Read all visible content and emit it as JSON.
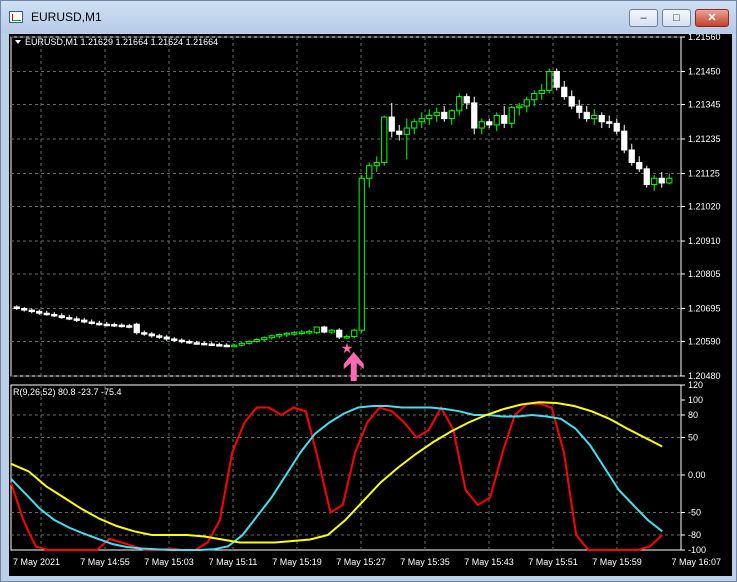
{
  "window": {
    "title": "EURUSD,M1",
    "controls": {
      "minimize": "–",
      "maximize": "□",
      "close": "✕"
    }
  },
  "chart_data": [
    {
      "type": "candlestick",
      "header": "EURUSD,M1  1.21629 1.21664 1.21624 1.21664",
      "price_labels": [
        "1.21560",
        "1.21450",
        "1.21345",
        "1.21235",
        "1.21125",
        "1.21020",
        "1.20910",
        "1.20805",
        "1.20695",
        "1.20590",
        "1.20480"
      ],
      "ylim": [
        1.2048,
        1.2156
      ],
      "colors": {
        "bull": "#00ff00",
        "bear": "#ffffff",
        "grid": "#5f6f5f",
        "signal_star": "#ff69b4",
        "signal_arrow": "#ff69b4"
      },
      "candles": [
        [
          1.207,
          1.20705,
          1.2069,
          1.20695
        ],
        [
          1.20695,
          1.207,
          1.20685,
          1.2069
        ],
        [
          1.2069,
          1.20695,
          1.2068,
          1.20686
        ],
        [
          1.20686,
          1.20692,
          1.20675,
          1.2068
        ],
        [
          1.2068,
          1.20688,
          1.20672,
          1.20676
        ],
        [
          1.20676,
          1.20684,
          1.20668,
          1.20672
        ],
        [
          1.20672,
          1.2068,
          1.20662,
          1.20666
        ],
        [
          1.20666,
          1.20674,
          1.20658,
          1.20662
        ],
        [
          1.20662,
          1.2067,
          1.20652,
          1.20658
        ],
        [
          1.20658,
          1.20665,
          1.20648,
          1.20652
        ],
        [
          1.20652,
          1.2066,
          1.20644,
          1.20648
        ],
        [
          1.20648,
          1.20656,
          1.2064,
          1.20645
        ],
        [
          1.20645,
          1.20652,
          1.20638,
          1.20644
        ],
        [
          1.20644,
          1.2065,
          1.20636,
          1.20642
        ],
        [
          1.20642,
          1.20648,
          1.20634,
          1.2064
        ],
        [
          1.2064,
          1.20646,
          1.20632,
          1.20638
        ],
        [
          1.20645,
          1.2065,
          1.20612,
          1.20618
        ],
        [
          1.20618,
          1.20625,
          1.20608,
          1.20614
        ],
        [
          1.20614,
          1.2062,
          1.20602,
          1.20608
        ],
        [
          1.20608,
          1.20614,
          1.20598,
          1.20604
        ],
        [
          1.20604,
          1.2061,
          1.20592,
          1.20598
        ],
        [
          1.20598,
          1.20604,
          1.20588,
          1.20594
        ],
        [
          1.20594,
          1.206,
          1.20584,
          1.2059
        ],
        [
          1.2059,
          1.20596,
          1.20582,
          1.20586
        ],
        [
          1.20586,
          1.20592,
          1.2058,
          1.20584
        ],
        [
          1.20584,
          1.2059,
          1.20578,
          1.20582
        ],
        [
          1.20582,
          1.20588,
          1.20576,
          1.2058
        ],
        [
          1.2058,
          1.20586,
          1.20574,
          1.20578
        ],
        [
          1.20578,
          1.20584,
          1.20573,
          1.20576
        ],
        [
          1.20576,
          1.20582,
          1.20572,
          1.20578
        ],
        [
          1.20578,
          1.20588,
          1.20574,
          1.20584
        ],
        [
          1.20584,
          1.20594,
          1.2058,
          1.2059
        ],
        [
          1.2059,
          1.206,
          1.20586,
          1.20596
        ],
        [
          1.20596,
          1.20606,
          1.2059,
          1.20602
        ],
        [
          1.20602,
          1.20612,
          1.20596,
          1.20608
        ],
        [
          1.20608,
          1.20616,
          1.206,
          1.20612
        ],
        [
          1.20612,
          1.2062,
          1.20604,
          1.20616
        ],
        [
          1.20616,
          1.20624,
          1.20608,
          1.20618
        ],
        [
          1.20618,
          1.20626,
          1.2061,
          1.2062
        ],
        [
          1.2062,
          1.20628,
          1.20612,
          1.20622
        ],
        [
          1.20618,
          1.2063,
          1.20614,
          1.20636
        ],
        [
          1.20636,
          1.2064,
          1.20616,
          1.2062
        ],
        [
          1.2062,
          1.2063,
          1.20614,
          1.20626
        ],
        [
          1.20626,
          1.20632,
          1.20598,
          1.20604
        ],
        [
          1.20604,
          1.20612,
          1.20598,
          1.20606
        ],
        [
          1.20606,
          1.2063,
          1.206,
          1.20626
        ],
        [
          1.20626,
          1.2112,
          1.20618,
          1.2111
        ],
        [
          1.2111,
          1.2116,
          1.2108,
          1.2115
        ],
        [
          1.2115,
          1.2118,
          1.2113,
          1.2116
        ],
        [
          1.2116,
          1.2131,
          1.2115,
          1.21305
        ],
        [
          1.21305,
          1.2135,
          1.2124,
          1.2126
        ],
        [
          1.2126,
          1.2128,
          1.2123,
          1.2125
        ],
        [
          1.2125,
          1.213,
          1.2117,
          1.2127
        ],
        [
          1.2127,
          1.213,
          1.2125,
          1.2129
        ],
        [
          1.2129,
          1.2132,
          1.2127,
          1.213
        ],
        [
          1.213,
          1.2133,
          1.2128,
          1.2131
        ],
        [
          1.2131,
          1.21335,
          1.2129,
          1.2132
        ],
        [
          1.2132,
          1.2134,
          1.2129,
          1.213
        ],
        [
          1.213,
          1.2133,
          1.2128,
          1.21325
        ],
        [
          1.21325,
          1.2138,
          1.2131,
          1.2137
        ],
        [
          1.2137,
          1.2138,
          1.2133,
          1.2135
        ],
        [
          1.2135,
          1.2137,
          1.2125,
          1.2127
        ],
        [
          1.2127,
          1.213,
          1.2125,
          1.2129
        ],
        [
          1.2129,
          1.213,
          1.2127,
          1.2128
        ],
        [
          1.2128,
          1.2132,
          1.2126,
          1.2131
        ],
        [
          1.2131,
          1.2134,
          1.2127,
          1.21285
        ],
        [
          1.21285,
          1.2134,
          1.2127,
          1.21335
        ],
        [
          1.21335,
          1.2135,
          1.2131,
          1.2134
        ],
        [
          1.2134,
          1.2137,
          1.2132,
          1.2136
        ],
        [
          1.2136,
          1.2139,
          1.2134,
          1.2138
        ],
        [
          1.2138,
          1.2141,
          1.2136,
          1.2139
        ],
        [
          1.2139,
          1.2146,
          1.2138,
          1.2145
        ],
        [
          1.2145,
          1.2146,
          1.2139,
          1.214
        ],
        [
          1.214,
          1.2142,
          1.2136,
          1.2137
        ],
        [
          1.2137,
          1.2139,
          1.2133,
          1.2134
        ],
        [
          1.2134,
          1.2136,
          1.213,
          1.2132
        ],
        [
          1.2132,
          1.2134,
          1.2129,
          1.213
        ],
        [
          1.213,
          1.2133,
          1.2128,
          1.2131
        ],
        [
          1.2131,
          1.2132,
          1.2127,
          1.2129
        ],
        [
          1.2129,
          1.2131,
          1.2127,
          1.21285
        ],
        [
          1.21285,
          1.213,
          1.2125,
          1.2126
        ],
        [
          1.2126,
          1.2128,
          1.2119,
          1.212
        ],
        [
          1.212,
          1.2122,
          1.2115,
          1.2116
        ],
        [
          1.2116,
          1.2118,
          1.2113,
          1.2114
        ],
        [
          1.2114,
          1.2115,
          1.2108,
          1.2109
        ],
        [
          1.2109,
          1.2112,
          1.2107,
          1.2111
        ],
        [
          1.2111,
          1.2113,
          1.2108,
          1.21095
        ],
        [
          1.21095,
          1.21125,
          1.2109,
          1.2111
        ]
      ],
      "signal_candle_index": 44
    },
    {
      "type": "line",
      "header": "R(9,26,52) 80.8 -23.7 -75.4",
      "ylim": [
        -100,
        120
      ],
      "scale_labels": [
        "120",
        "100",
        "80",
        "50",
        "0.00",
        "-50",
        "-80",
        "-100"
      ],
      "scale_values": [
        120,
        100,
        80,
        50,
        0,
        -50,
        -80,
        -100
      ],
      "x_tick_labels": [
        "7 May 2021",
        "7 May 14:55",
        "7 May 15:03",
        "7 May 15:11",
        "7 May 15:19",
        "7 May 15:27",
        "7 May 15:35",
        "7 May 15:43",
        "7 May 15:51",
        "7 May 15:59",
        "7 May 16:07"
      ],
      "series": [
        {
          "color": "#ff0000",
          "values": [
            -10,
            -60,
            -95,
            -100,
            -100,
            -100,
            -100,
            -100,
            -85,
            -90,
            -95,
            -100,
            -100,
            -98,
            -100,
            -100,
            -90,
            -60,
            30,
            70,
            90,
            90,
            80,
            90,
            85,
            20,
            -50,
            -40,
            30,
            70,
            90,
            85,
            70,
            50,
            60,
            90,
            60,
            -20,
            -40,
            -30,
            30,
            80,
            95,
            95,
            90,
            30,
            -80,
            -100,
            -100,
            -100,
            -100,
            -100,
            -95,
            -80
          ]
        },
        {
          "color": "#40e0f0",
          "values": [
            -5,
            -25,
            -45,
            -60,
            -70,
            -78,
            -85,
            -92,
            -96,
            -98,
            -99,
            -100,
            -100,
            -100,
            -99,
            -95,
            -80,
            -55,
            -30,
            0,
            30,
            55,
            70,
            82,
            90,
            92,
            92,
            90,
            90,
            90,
            88,
            85,
            80,
            80,
            78,
            78,
            80,
            78,
            75,
            62,
            40,
            10,
            -20,
            -40,
            -60,
            -75
          ]
        },
        {
          "color": "#ffff00",
          "values": [
            15,
            5,
            -15,
            -30,
            -45,
            -58,
            -68,
            -75,
            -80,
            -80,
            -80,
            -82,
            -86,
            -90,
            -90,
            -90,
            -88,
            -86,
            -80,
            -60,
            -35,
            -10,
            10,
            28,
            44,
            58,
            70,
            80,
            88,
            94,
            97,
            96,
            92,
            85,
            75,
            62,
            50,
            38
          ]
        }
      ],
      "series_x_end": [
        0.972,
        0.972,
        0.972
      ]
    }
  ]
}
